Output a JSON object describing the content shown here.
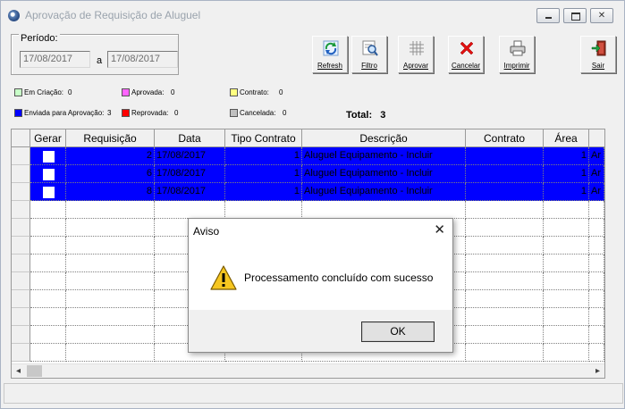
{
  "window": {
    "title": "Aprovação de Requisição de Aluguel",
    "controls": {
      "minimize": "minimize",
      "maximize": "maximize",
      "close": "✕"
    }
  },
  "periodo": {
    "label": "Período:",
    "from": "17/08/2017",
    "sep": "a",
    "to": "17/08/2017"
  },
  "toolbar": [
    {
      "label": "Refresh",
      "icon": "refresh-icon"
    },
    {
      "label": "Filtro",
      "icon": "filter-icon"
    },
    {
      "label": "Aprovar",
      "icon": "approve-grid-icon"
    },
    {
      "label": "Cancelar",
      "icon": "cancel-x-icon"
    },
    {
      "label": "Imprimir",
      "icon": "printer-icon"
    },
    {
      "label": "Sair",
      "icon": "exit-door-icon"
    }
  ],
  "legend": [
    {
      "label": "Em Criação:",
      "count": "0",
      "color": "#c8ffc8"
    },
    {
      "label": "Aprovada:",
      "count": "0",
      "color": "#ff64ff"
    },
    {
      "label": "Contrato:",
      "count": "0",
      "color": "#ffff80"
    },
    {
      "label": "Enviada para Aprovação:",
      "count": "3",
      "color": "#0000ff"
    },
    {
      "label": "Reprovada:",
      "count": "0",
      "color": "#ff0000"
    },
    {
      "label": "Cancelada:",
      "count": "0",
      "color": "#c0c0c0"
    }
  ],
  "total": {
    "label": "Total:",
    "value": "3"
  },
  "grid": {
    "columns": [
      "Gerar",
      "Requisição",
      "Data",
      "Tipo Contrato",
      "Descrição",
      "Contrato",
      "Área"
    ],
    "rows": [
      {
        "gerar": false,
        "requisicao": "2",
        "data": "17/08/2017",
        "tipo": "1",
        "descricao": "Aluguel Equipamento - Incluir",
        "contrato": "",
        "area": "1",
        "extra": "Ar"
      },
      {
        "gerar": false,
        "requisicao": "6",
        "data": "17/08/2017",
        "tipo": "1",
        "descricao": "Aluguel Equipamento - Incluir",
        "contrato": "",
        "area": "1",
        "extra": "Ar"
      },
      {
        "gerar": false,
        "requisicao": "8",
        "data": "17/08/2017",
        "tipo": "1",
        "descricao": "Aluguel Equipamento - Incluir",
        "contrato": "",
        "area": "1",
        "extra": "Ar"
      }
    ],
    "selection_color": "#0000ff",
    "scroll_left": "◂",
    "scroll_right": "▸"
  },
  "dialog": {
    "title": "Aviso",
    "close": "✕",
    "message": "Processamento concluído com sucesso",
    "ok": "OK",
    "icon": "warning-icon"
  }
}
